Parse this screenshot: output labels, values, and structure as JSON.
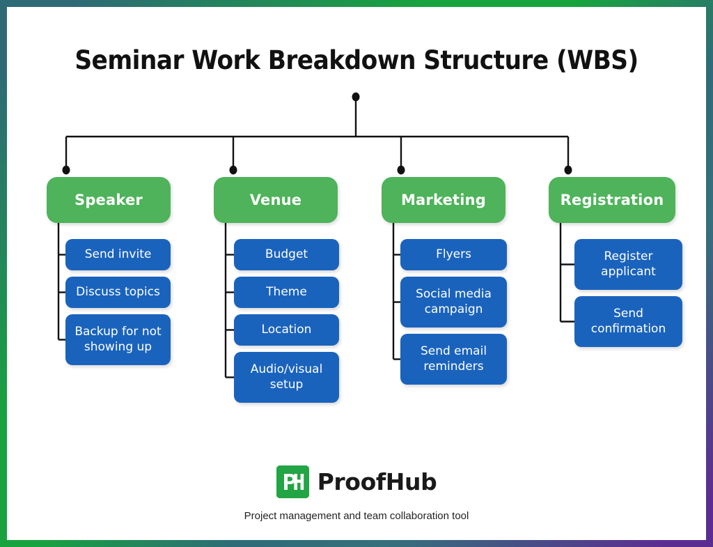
{
  "poster": {
    "title": "Seminar Work Breakdown Structure (WBS)",
    "border_colors": {
      "top_left": "#2e6a76",
      "top_right": "#18a33f",
      "bottom_right": "#2e6a76",
      "bottom_left": "#5c2d91"
    },
    "parent_color": "#4eb35a",
    "child_color": "#1a63bd",
    "connector_color": "#111111"
  },
  "chart_data": {
    "type": "diagram",
    "title": "Seminar Work Breakdown Structure (WBS)",
    "root": {
      "label": "",
      "node_type": "root-dot"
    },
    "branches": [
      {
        "label": "Speaker",
        "tasks": [
          {
            "label": "Send invite",
            "lines": 1
          },
          {
            "label": "Discuss topics",
            "lines": 1
          },
          {
            "label": "Backup for not showing up",
            "lines": 2
          }
        ]
      },
      {
        "label": "Venue",
        "tasks": [
          {
            "label": "Budget",
            "lines": 1
          },
          {
            "label": "Theme",
            "lines": 1
          },
          {
            "label": "Location",
            "lines": 1
          },
          {
            "label": "Audio/visual setup",
            "lines": 2
          }
        ]
      },
      {
        "label": "Marketing",
        "tasks": [
          {
            "label": "Flyers",
            "lines": 1
          },
          {
            "label": "Social media campaign",
            "lines": 2
          },
          {
            "label": "Send email reminders",
            "lines": 2
          }
        ]
      },
      {
        "label": "Registration",
        "tasks": [
          {
            "label": "Register applicant",
            "lines": 2
          },
          {
            "label": "Send confirmation",
            "lines": 2
          }
        ]
      }
    ]
  },
  "footer": {
    "logo_text": "PH",
    "brand_name": "ProofHub",
    "tagline": "Project management and team collaboration tool",
    "logo_bg": "#22a544"
  }
}
